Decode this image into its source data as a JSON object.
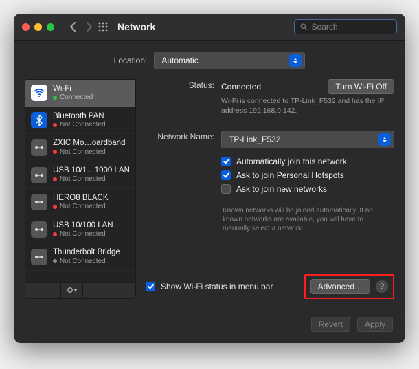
{
  "window": {
    "title": "Network"
  },
  "search": {
    "placeholder": "Search"
  },
  "location": {
    "label": "Location:",
    "value": "Automatic"
  },
  "sidebar": {
    "items": [
      {
        "name": "Wi-Fi",
        "status": "Connected",
        "connected": true,
        "icon": "wifi"
      },
      {
        "name": "Bluetooth PAN",
        "status": "Not Connected",
        "connected": false,
        "icon": "bt"
      },
      {
        "name": "ZXIC Mo…oardband",
        "status": "Not Connected",
        "connected": false,
        "icon": "generic"
      },
      {
        "name": "USB 10/1…1000 LAN",
        "status": "Not Connected",
        "connected": false,
        "icon": "generic"
      },
      {
        "name": "HERO8 BLACK",
        "status": "Not Connected",
        "connected": false,
        "icon": "generic"
      },
      {
        "name": "USB 10/100 LAN",
        "status": "Not Connected",
        "connected": false,
        "icon": "generic"
      },
      {
        "name": "Thunderbolt Bridge",
        "status": "Not Connected",
        "connected": false,
        "icon": "generic"
      }
    ]
  },
  "status": {
    "label": "Status:",
    "value": "Connected",
    "toggle": "Turn Wi-Fi Off",
    "desc": "Wi-Fi is connected to TP-Link_F532 and has the IP address 192.168.0.142."
  },
  "network_name": {
    "label": "Network Name:",
    "value": "TP-Link_F532"
  },
  "checks": {
    "auto_join": "Automatically join this network",
    "hotspots": "Ask to join Personal Hotspots",
    "new_networks": "Ask to join new networks",
    "new_networks_desc": "Known networks will be joined automatically. If no known networks are available, you will have to manually select a network."
  },
  "menubar": {
    "label": "Show Wi-Fi status in menu bar"
  },
  "buttons": {
    "advanced": "Advanced…",
    "revert": "Revert",
    "apply": "Apply",
    "help": "?"
  }
}
